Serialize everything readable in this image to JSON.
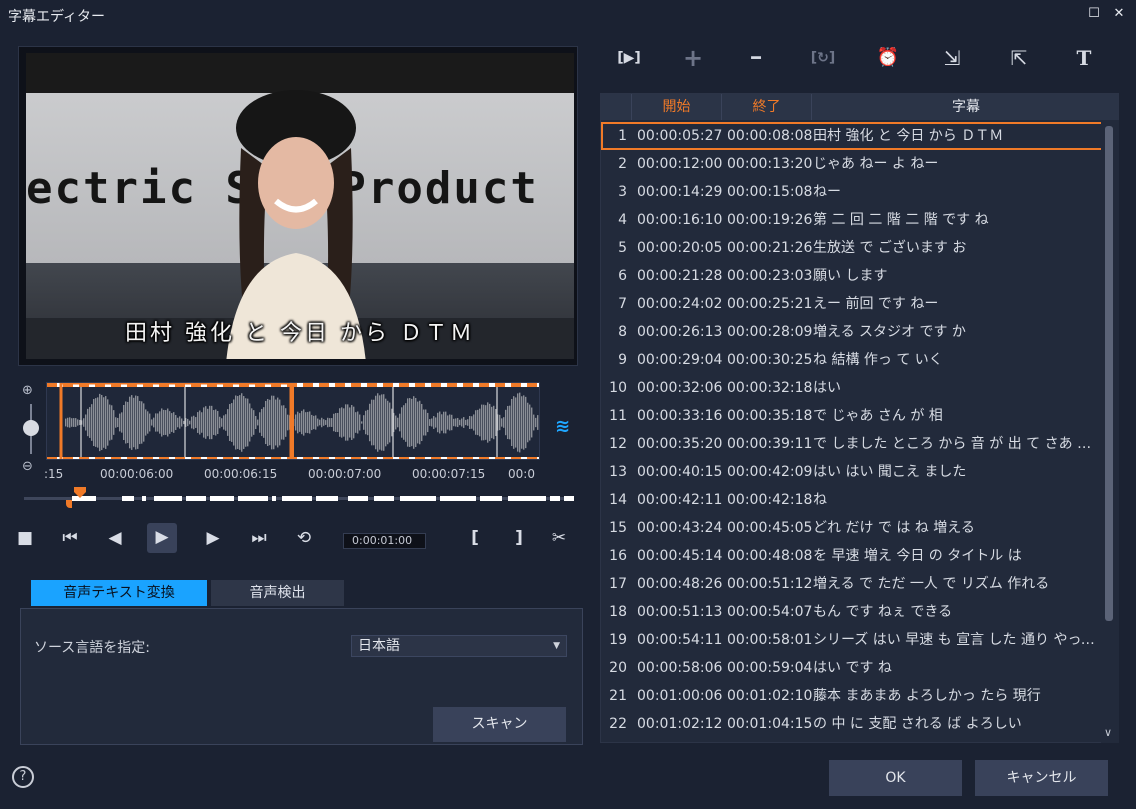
{
  "window": {
    "title": "字幕エディター",
    "maximize_glyph": "☐",
    "close_glyph": "✕"
  },
  "preview": {
    "caption": "田村 強化 と 今日 から ＤＴＭ",
    "banner_text": "ectric S   l Product"
  },
  "timeline": {
    "tick_labels": [
      ":15",
      "00:00:06:00",
      "00:00:06:15",
      "00:00:07:00",
      "00:00:07:15",
      "00:0"
    ],
    "timecode": "0:00:01:00"
  },
  "transport": {
    "stop": "■",
    "prev": "⏮",
    "step_back": "◀",
    "play": "▶",
    "step_fwd": "▶",
    "next": "⏭",
    "repeat": "⟲",
    "mark_in": "[",
    "mark_out": "]",
    "cut": "✂"
  },
  "tabs": {
    "speech_to_text": "音声テキスト変換",
    "voice_detect": "音声検出"
  },
  "panel": {
    "source_language_label": "ソース言語を指定:",
    "source_language_value": "日本語",
    "scan_button": "スキャン"
  },
  "toolbar": {
    "play_subtitle": "[▶]",
    "add": "+",
    "remove": "━",
    "merge": "[↻]",
    "sync": "⏰",
    "import": "⇲",
    "export": "⇱",
    "text": "T"
  },
  "table": {
    "columns": {
      "start": "開始",
      "end": "終了",
      "subtitle": "字幕"
    },
    "header_color": "#f07a28",
    "rows": [
      {
        "n": "1",
        "start": "00:00:05:27",
        "end": "00:00:08:08",
        "text": "田村 強化 と 今日 から ＤＴＭ"
      },
      {
        "n": "2",
        "start": "00:00:12:00",
        "end": "00:00:13:20",
        "text": "じゃあ ねー よ ねー"
      },
      {
        "n": "3",
        "start": "00:00:14:29",
        "end": "00:00:15:08",
        "text": "ねー"
      },
      {
        "n": "4",
        "start": "00:00:16:10",
        "end": "00:00:19:26",
        "text": "第 二 回 二 階 二 階 です ね"
      },
      {
        "n": "5",
        "start": "00:00:20:05",
        "end": "00:00:21:26",
        "text": "生放送 で ございます お"
      },
      {
        "n": "6",
        "start": "00:00:21:28",
        "end": "00:00:23:03",
        "text": "願い します"
      },
      {
        "n": "7",
        "start": "00:00:24:02",
        "end": "00:00:25:21",
        "text": "えー 前回 です ねー"
      },
      {
        "n": "8",
        "start": "00:00:26:13",
        "end": "00:00:28:09",
        "text": "増える スタジオ です か"
      },
      {
        "n": "9",
        "start": "00:00:29:04",
        "end": "00:00:30:25",
        "text": "ね 結構 作っ て いく"
      },
      {
        "n": "10",
        "start": "00:00:32:06",
        "end": "00:00:32:18",
        "text": "はい"
      },
      {
        "n": "11",
        "start": "00:00:33:16",
        "end": "00:00:35:18",
        "text": "で じゃあ さん が 相"
      },
      {
        "n": "12",
        "start": "00:00:35:20",
        "end": "00:00:39:11",
        "text": "で しました ところ から 音 が 出 て さあ て い…"
      },
      {
        "n": "13",
        "start": "00:00:40:15",
        "end": "00:00:42:09",
        "text": "はい はい 聞こえ ました"
      },
      {
        "n": "14",
        "start": "00:00:42:11",
        "end": "00:00:42:18",
        "text": "ね"
      },
      {
        "n": "15",
        "start": "00:00:43:24",
        "end": "00:00:45:05",
        "text": "どれ だけ で は ね 増える"
      },
      {
        "n": "16",
        "start": "00:00:45:14",
        "end": "00:00:48:08",
        "text": "を 早速 増え 今日 の タイトル は"
      },
      {
        "n": "17",
        "start": "00:00:48:26",
        "end": "00:00:51:12",
        "text": "増える で ただ 一人 で リズム 作れる"
      },
      {
        "n": "18",
        "start": "00:00:51:13",
        "end": "00:00:54:07",
        "text": "もん です ねぇ できる"
      },
      {
        "n": "19",
        "start": "00:00:54:11",
        "end": "00:00:58:01",
        "text": "シリーズ はい 早速 も 宣言 した 通り やって…"
      },
      {
        "n": "20",
        "start": "00:00:58:06",
        "end": "00:00:59:04",
        "text": "はい です ね"
      },
      {
        "n": "21",
        "start": "00:01:00:06",
        "end": "00:01:02:10",
        "text": "藤本 まあまあ よろしかっ たら 現行"
      },
      {
        "n": "22",
        "start": "00:01:02:12",
        "end": "00:01:04:15",
        "text": "の 中 に 支配 される ば よろしい"
      }
    ],
    "selected_row": 0
  },
  "footer": {
    "help_glyph": "?",
    "ok": "OK",
    "cancel": "キャンセル"
  },
  "colors": {
    "accent_blue": "#1aa3ff",
    "accent_orange": "#f07a28",
    "background": "#1b2232"
  }
}
